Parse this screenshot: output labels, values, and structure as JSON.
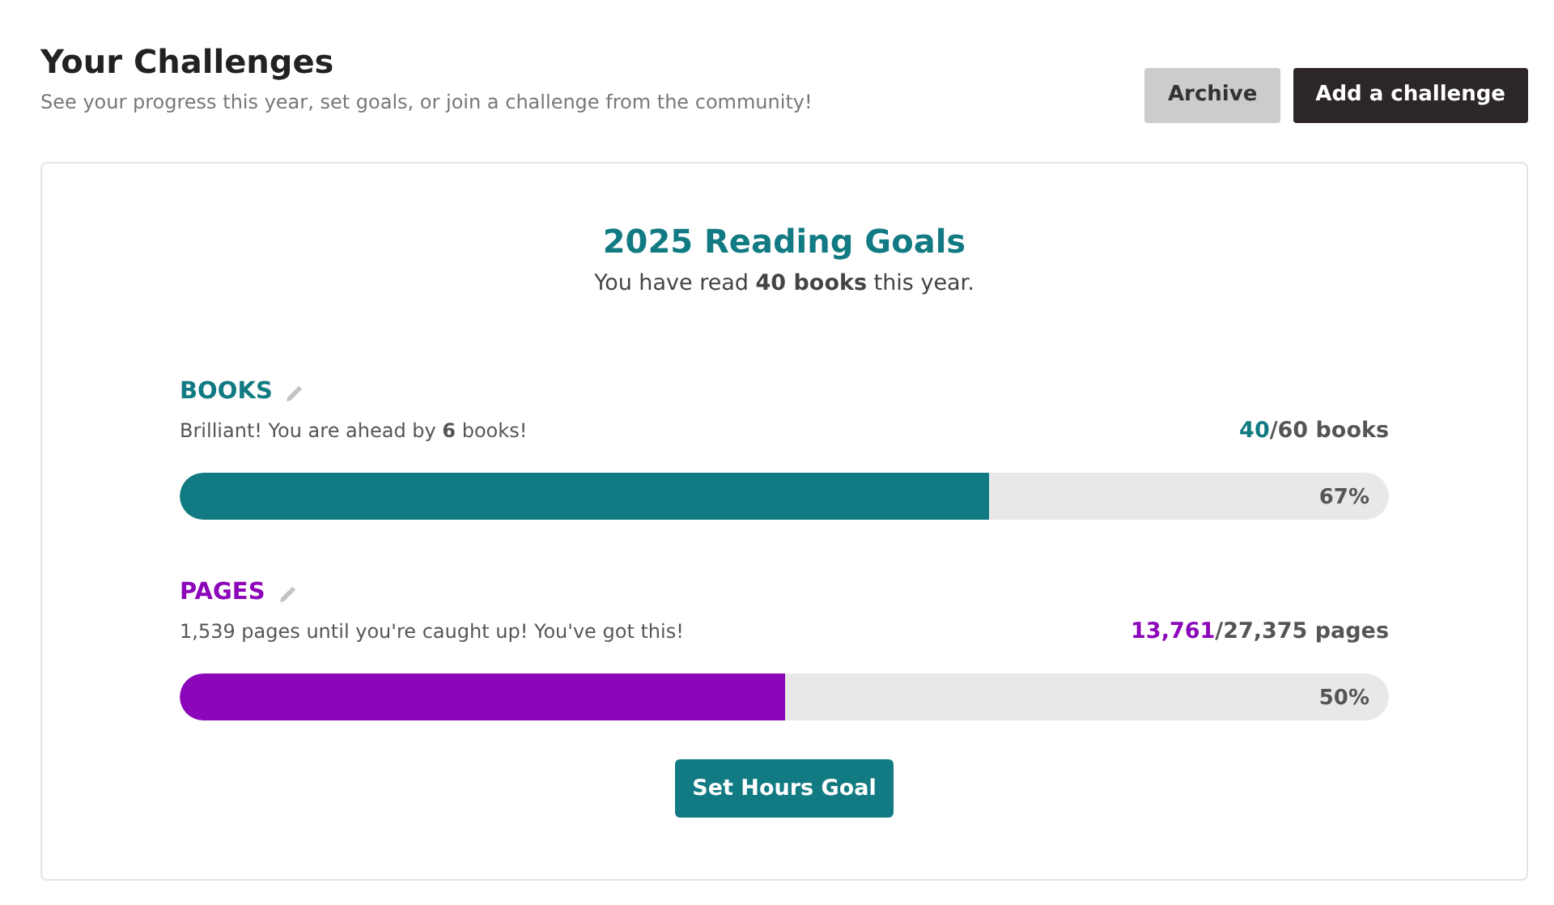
{
  "header": {
    "title": "Your Challenges",
    "subtitle": "See your progress this year, set goals, or join a challenge from the community!",
    "buttons": [
      {
        "label": "Archive",
        "kind": "secondary"
      },
      {
        "label": "Add a challenge",
        "kind": "primary"
      }
    ]
  },
  "card": {
    "title": "2025 Reading Goals",
    "summary": "You have read **40 books** this year.",
    "goals": [
      {
        "label": "BOOKS",
        "color": "#117a82",
        "message": "Brilliant! You are ahead by **6** books!",
        "done": "40",
        "total": "/60 books",
        "level": 0.67,
        "percent": "67%"
      },
      {
        "label": "PAGES",
        "color": "#8c06ba",
        "message": "1,539 pages until you're caught up! You've got this!",
        "done": "13,761",
        "total": "/27,375 pages",
        "level": 0.5,
        "percent": "50%"
      }
    ],
    "action": "Set Hours Goal"
  }
}
